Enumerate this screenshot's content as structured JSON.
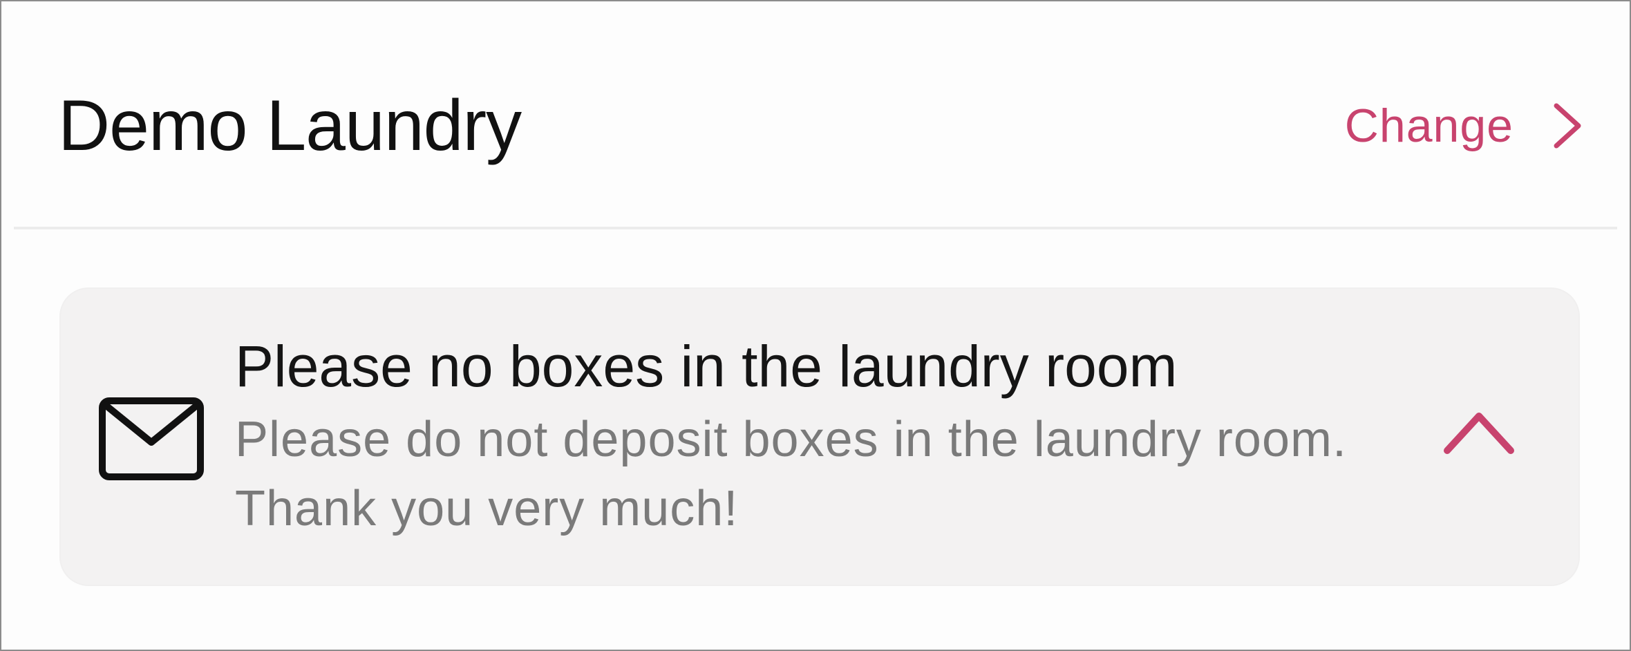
{
  "header": {
    "title": "Demo Laundry",
    "change_label": "Change",
    "chevron_icon": "chevron-right-icon"
  },
  "notice": {
    "icon": "mail-icon",
    "title": "Please no boxes in the laundry room",
    "body": "Please do not deposit boxes in the laundry room. Thank you very much!",
    "toggle_icon": "chevron-up-icon",
    "expanded": true
  },
  "colors": {
    "accent": "#c8436e",
    "title_text": "#111111",
    "body_text": "#7a7a7a",
    "card_background": "#f3f2f2",
    "divider": "#ececec"
  }
}
